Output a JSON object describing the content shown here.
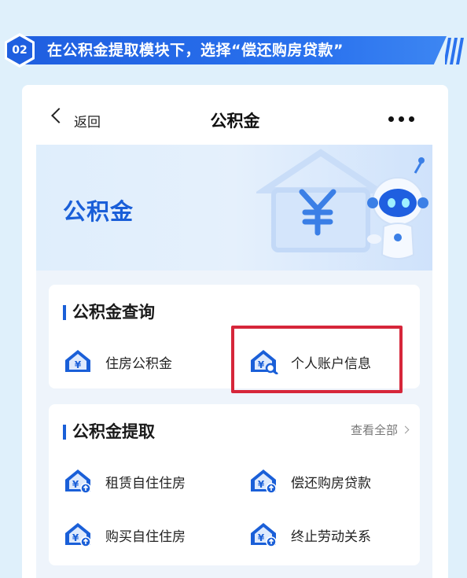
{
  "step": {
    "number": "02",
    "title": "在公积金提取模块下，选择“偿还购房贷款”"
  },
  "navbar": {
    "back_label": "返回",
    "title": "公积金"
  },
  "hero": {
    "title": "公积金"
  },
  "query_card": {
    "heading": "公积金查询",
    "items": [
      {
        "label": "住房公积金",
        "icon": "house-yuan-icon"
      },
      {
        "label": "个人账户信息",
        "icon": "house-yuan-search-icon"
      }
    ]
  },
  "withdraw_card": {
    "heading": "公积金提取",
    "view_all": "查看全部",
    "items": [
      {
        "label": "租赁自住住房",
        "icon": "house-yuan-arrow-icon"
      },
      {
        "label": "偿还购房贷款",
        "icon": "house-yuan-arrow-icon"
      },
      {
        "label": "购买自住住房",
        "icon": "house-yuan-arrow-icon"
      },
      {
        "label": "终止劳动关系",
        "icon": "house-yuan-arrow-icon"
      }
    ]
  },
  "colors": {
    "accent": "#1a5fd8",
    "banner": "#1f5fe0",
    "highlight": "#d6263a",
    "background": "#dff0fb"
  }
}
